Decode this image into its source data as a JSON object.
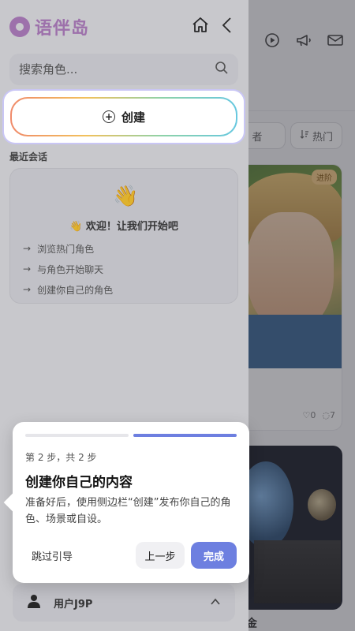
{
  "app": {
    "name": "语伴岛"
  },
  "search": {
    "placeholder": "搜索角色..."
  },
  "sidebar": {
    "create_label": "创建",
    "recent_title": "最近会话",
    "welcome": {
      "emoji": "👋",
      "heading": "👋 欢迎！让我们开始吧",
      "tips": [
        "浏览热门角色",
        "与角色开始聊天",
        "创建你自己的角色"
      ]
    },
    "user": {
      "name": "用户J9P"
    }
  },
  "main": {
    "filters": [
      {
        "label": "者"
      },
      {
        "label": "热门"
      }
    ],
    "cards": [
      {
        "badge": "进阶",
        "likes": "0",
        "comments": "7"
      },
      {
        "title_fragment": "金"
      }
    ]
  },
  "tour": {
    "step_label": "第 2 步，共 2 步",
    "progress": {
      "current": 2,
      "total": 2
    },
    "title": "创建你自己的内容",
    "description": "准备好后，使用侧边栏“创建”发布你自己的角色、场景或自设。",
    "skip_label": "跳过引导",
    "prev_label": "上一步",
    "done_label": "完成"
  },
  "colors": {
    "accent": "#6d7fe0",
    "brand": "#b07ac0"
  },
  "icons": {
    "home": "home-icon",
    "back": "chevron-left-icon",
    "search": "search-icon",
    "play": "play-icon",
    "announce": "megaphone-icon",
    "mail": "mail-icon",
    "sort": "sort-icon",
    "user": "user-icon",
    "chevron_up": "chevron-up-icon",
    "heart": "heart-icon",
    "comment": "comment-icon",
    "plus": "plus-circle-icon"
  }
}
